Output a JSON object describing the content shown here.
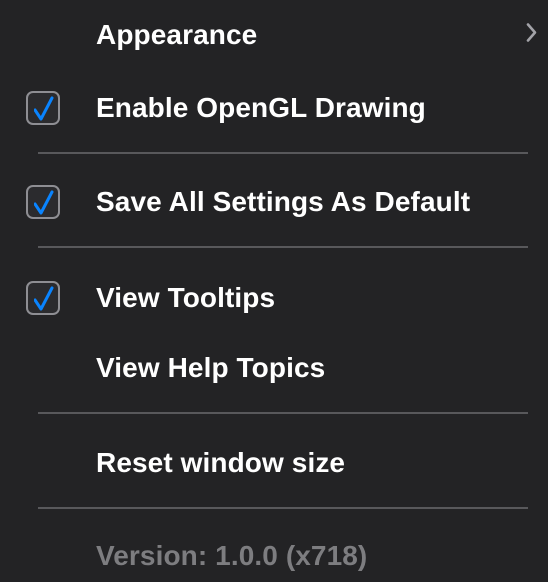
{
  "menu": {
    "appearance": {
      "label": "Appearance",
      "submenu_icon": "chevron-right-icon"
    },
    "opengl": {
      "label": "Enable OpenGL Drawing",
      "checked": true
    },
    "save_defaults": {
      "label": "Save All Settings As Default",
      "checked": true
    },
    "tooltips": {
      "label": "View Tooltips",
      "checked": true
    },
    "help_topics": {
      "label": "View Help Topics"
    },
    "reset_window": {
      "label": "Reset window size"
    },
    "version": {
      "label": "Version: 1.0.0 (x718)"
    }
  },
  "colors": {
    "menu_background": "#232325",
    "text": "#ffffff",
    "disabled_text": "#7d7d80",
    "checkmark": "#0a84ff",
    "separator": "#58585b"
  }
}
